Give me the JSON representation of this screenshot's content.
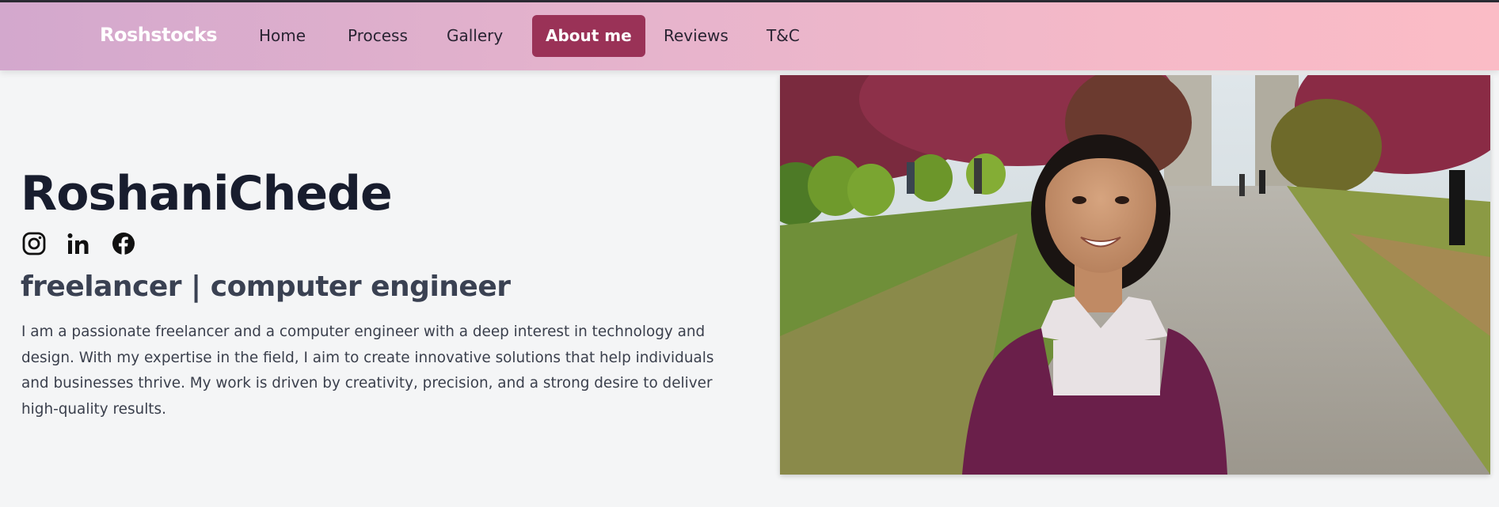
{
  "nav": {
    "brand": "Roshstocks",
    "links": [
      {
        "label": "Home",
        "active": false
      },
      {
        "label": "Process",
        "active": false
      },
      {
        "label": "Gallery",
        "active": false
      },
      {
        "label": "About me",
        "active": true
      },
      {
        "label": "Reviews",
        "active": false
      },
      {
        "label": "T&C",
        "active": false
      }
    ]
  },
  "hero": {
    "name": "RoshaniChede",
    "subtitle": "freelancer | computer engineer",
    "bio": "I am a passionate freelancer and a computer engineer with a deep interest in technology and design. With my expertise in the field, I aim to create innovative solutions that help individuals and businesses thrive. My work is driven by creativity, precision, and a strong desire to deliver high-quality results.",
    "socials": [
      "instagram-icon",
      "linkedin-icon",
      "facebook-icon"
    ]
  },
  "colors": {
    "accent": "#9a3257",
    "nav_gradient_start": "#d3a8cd",
    "nav_gradient_end": "#fbbcc6",
    "page_bg": "#f4f5f6",
    "title_text": "#181d2e"
  }
}
